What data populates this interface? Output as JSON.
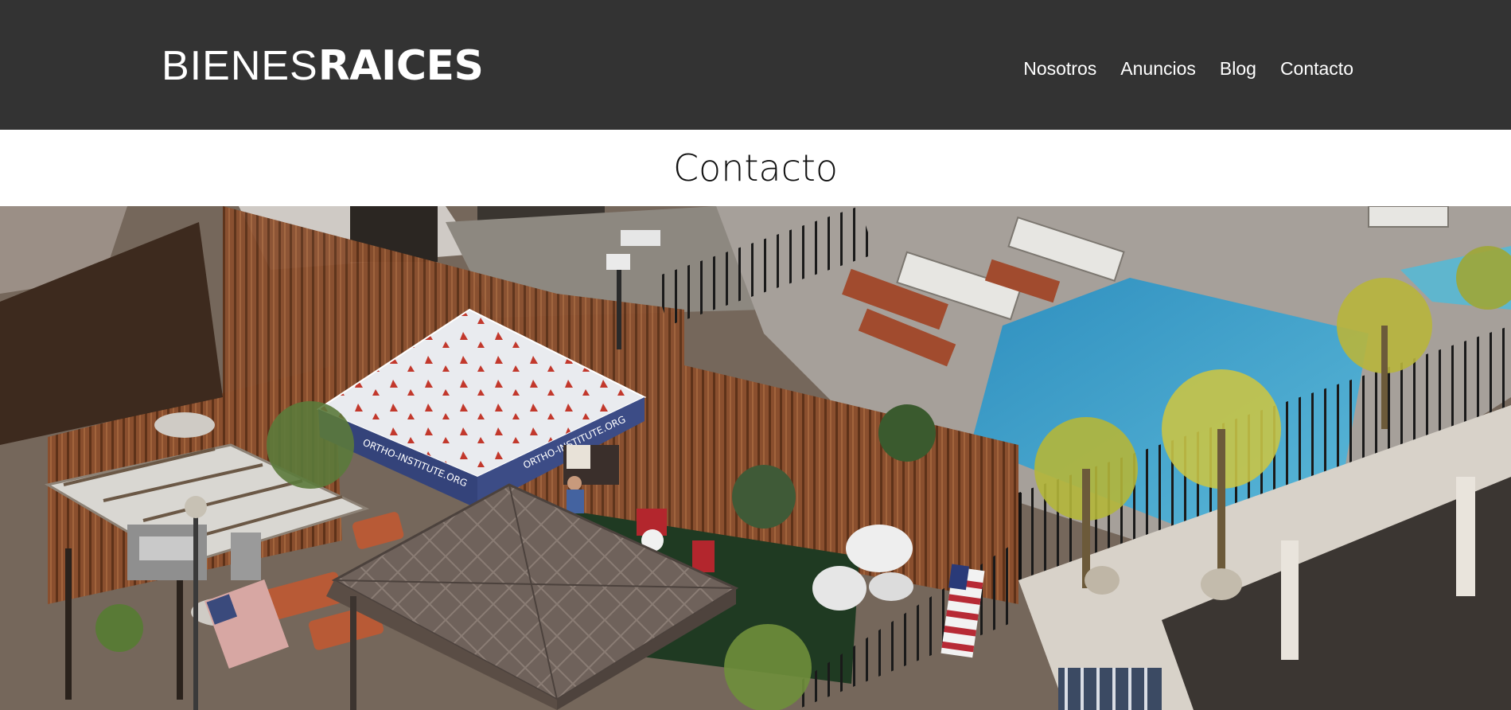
{
  "header": {
    "logo": {
      "light": "BIENES",
      "bold": "RAICES"
    },
    "nav": [
      {
        "label": "Nosotros"
      },
      {
        "label": "Anuncios"
      },
      {
        "label": "Blog"
      },
      {
        "label": "Contacto"
      }
    ]
  },
  "main": {
    "title": "Contacto",
    "hero_image": {
      "subject": "rooftop terrace with pool, gazebos and tents",
      "tent_text": "ORTHO-INSTITUTE.ORG"
    }
  },
  "colors": {
    "header_bg": "#333333",
    "text_light": "#ffffff",
    "pool": "#3fa3c9"
  }
}
